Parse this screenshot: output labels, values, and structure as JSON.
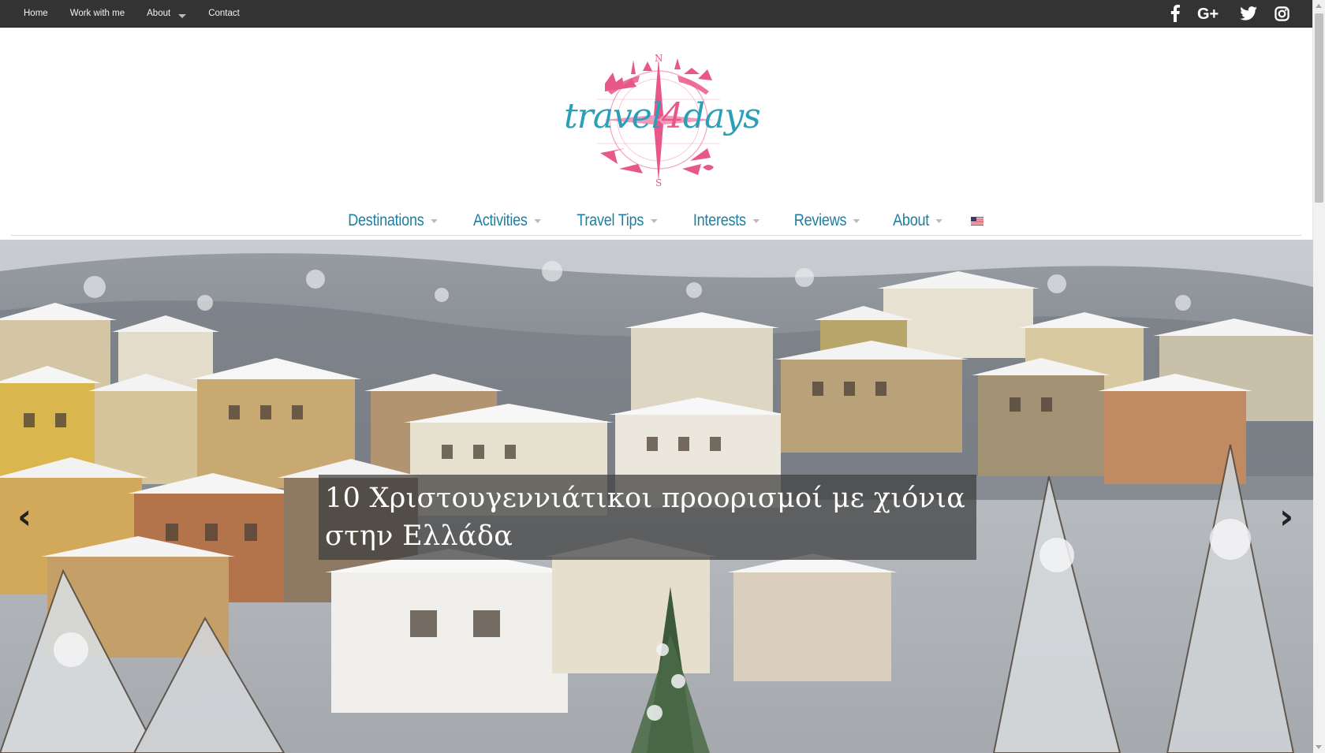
{
  "topbar": {
    "links": [
      {
        "label": "Home"
      },
      {
        "label": "Work with me"
      },
      {
        "label": "About",
        "dropdown": true
      },
      {
        "label": "Contact"
      }
    ],
    "social": [
      {
        "icon": "facebook-icon",
        "glyph": "f"
      },
      {
        "icon": "google-plus-icon",
        "glyph": "G+"
      },
      {
        "icon": "twitter-icon",
        "glyph": "twitter"
      },
      {
        "icon": "instagram-icon",
        "glyph": "instagram"
      }
    ]
  },
  "logo": {
    "text_before": "travel",
    "text_number": "4",
    "text_after": "days",
    "compass_letters": {
      "north": "N",
      "south": "S"
    },
    "colors": {
      "text": "#2a9fb8",
      "accent": "#e8578a"
    }
  },
  "mainnav": {
    "items": [
      {
        "label": "Destinations"
      },
      {
        "label": "Activities"
      },
      {
        "label": "Travel Tips"
      },
      {
        "label": "Interests"
      },
      {
        "label": "Reviews"
      },
      {
        "label": "About"
      }
    ],
    "language_flag": "us-flag-icon"
  },
  "hero": {
    "caption": "10 Χριστουγεννιάτικοι προορισμοί με χιόνια στην Ελλάδα",
    "prev": "‹",
    "next": "›",
    "image_subject": "snowy village"
  }
}
